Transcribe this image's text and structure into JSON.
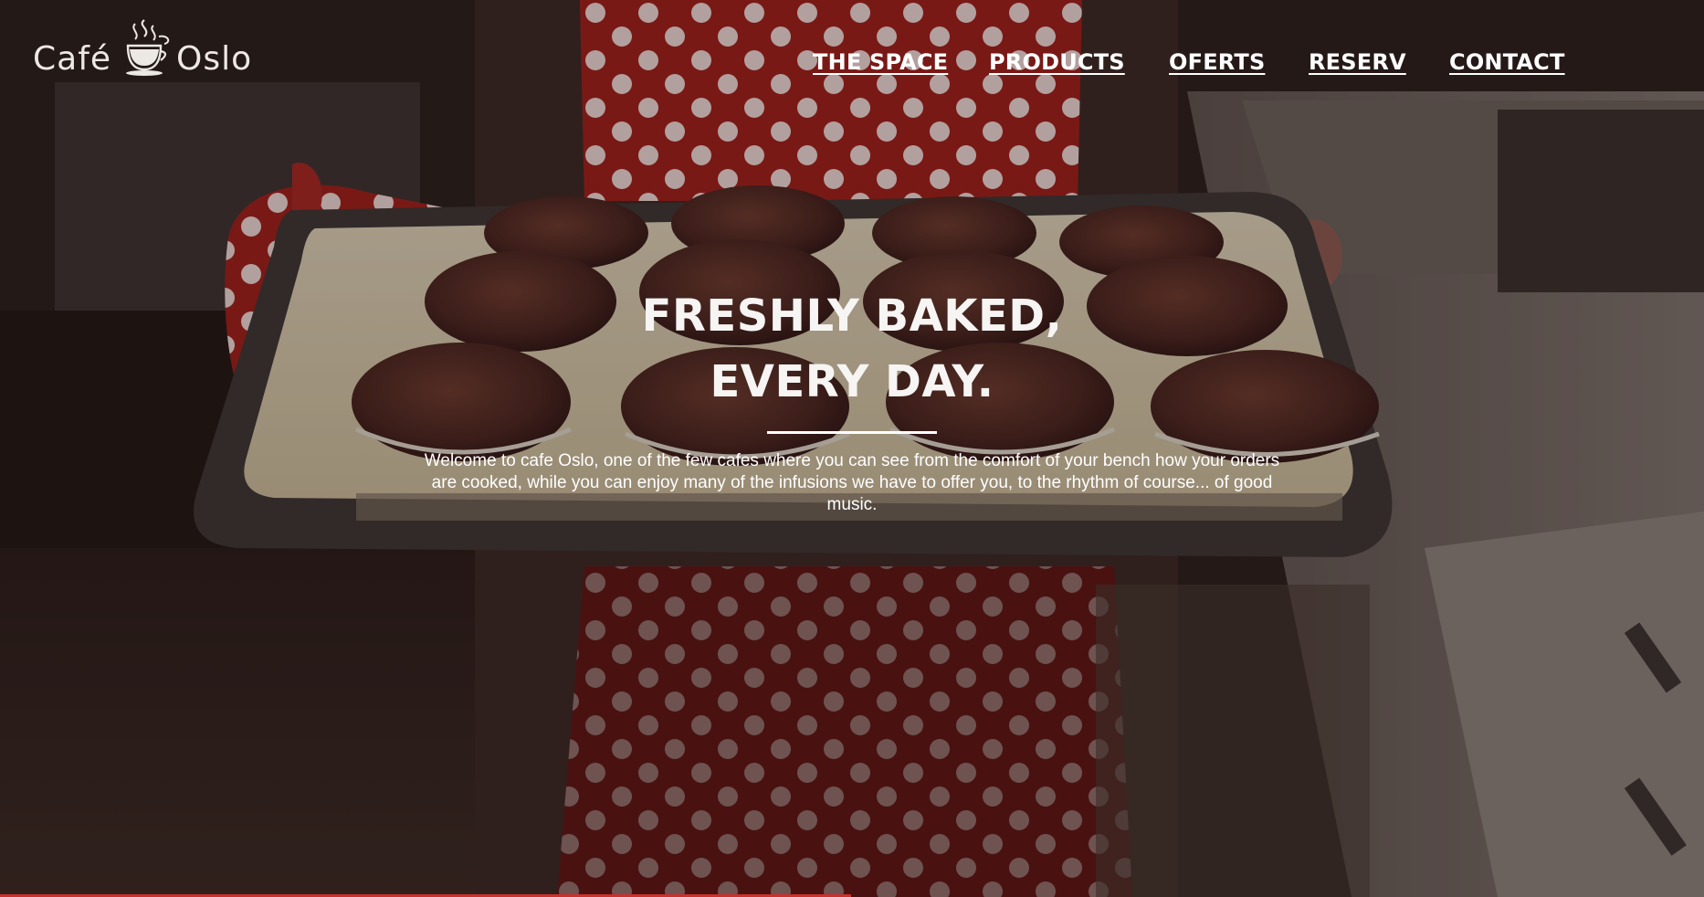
{
  "brand": {
    "name_left": "Café",
    "name_right": "Oslo",
    "logo_icon": "steaming-cup-icon"
  },
  "nav": {
    "items": [
      {
        "label": "THE SPACE"
      },
      {
        "label": "PRODUCTS"
      },
      {
        "label": "OFERTS"
      },
      {
        "label": "RESERV"
      },
      {
        "label": "CONTACT"
      }
    ]
  },
  "hero": {
    "title_line1": "FRESHLY BAKED,",
    "title_line2": "EVERY DAY.",
    "intro": "Welcome to cafe Oslo, one of the few cafes where you can see from the comfort of your bench how your orders are cooked, while you can enjoy many of the infusions we have to offer you, to the rhythm of course... of good music.",
    "background_image": "muffin-tray-photo"
  },
  "colors": {
    "text": "#ffffff",
    "accent": "#c9322c",
    "apron_red": "#b3231f",
    "muffin": "#5a2f26"
  }
}
